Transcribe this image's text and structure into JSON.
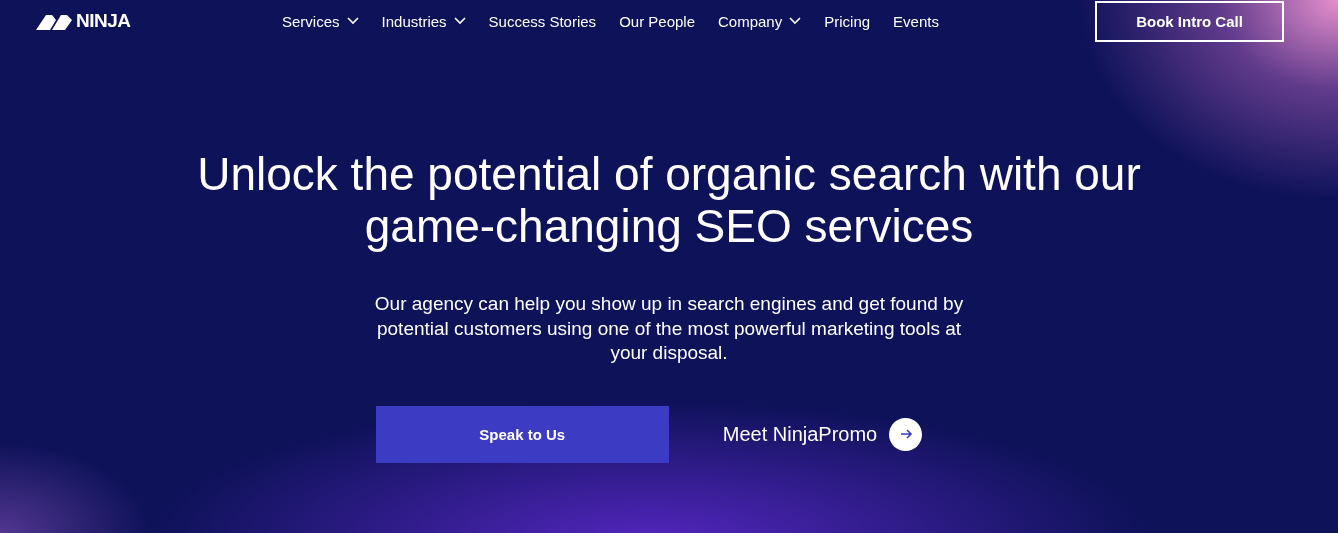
{
  "header": {
    "logo": "NINJA",
    "nav": [
      {
        "label": "Services",
        "dropdown": true
      },
      {
        "label": "Industries",
        "dropdown": true
      },
      {
        "label": "Success Stories",
        "dropdown": false
      },
      {
        "label": "Our People",
        "dropdown": false
      },
      {
        "label": "Company",
        "dropdown": true
      },
      {
        "label": "Pricing",
        "dropdown": false
      },
      {
        "label": "Events",
        "dropdown": false
      }
    ],
    "cta": "Book Intro Call"
  },
  "hero": {
    "headline": "Unlock the potential of organic search with our game-changing SEO services",
    "text": "Our agency can help you show up in search engines and get found by potential customers using one of the most powerful marketing tools at your disposal.",
    "primary_button": "Speak to Us",
    "secondary_link": "Meet NinjaPromo"
  }
}
